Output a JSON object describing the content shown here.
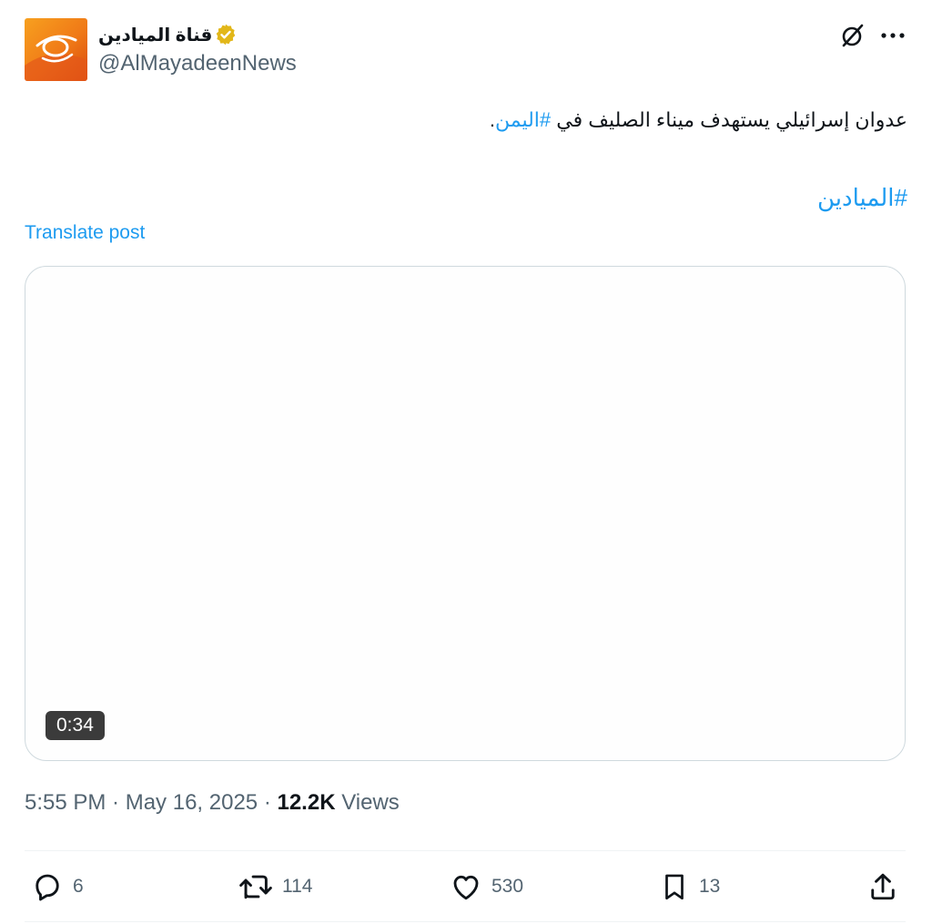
{
  "author": {
    "display_name": "قناة الميادين",
    "handle": "@AlMayadeenNews",
    "verified_icon": "verified-gold-badge-icon",
    "avatar_colors": {
      "orange": "#f07a17",
      "dark_orange": "#d9480b"
    }
  },
  "header_actions": {
    "grok_icon": "grok-icon",
    "more_icon": "more-horizontal-icon"
  },
  "post": {
    "line1_text": "عدوان إسرائيلي يستهدف ميناء الصليف في ",
    "line1_hashtag": "#اليمن",
    "line1_end": ".",
    "line2_hashtag": "#الميادين",
    "translate_label": "Translate post"
  },
  "media": {
    "duration": "0:34"
  },
  "meta": {
    "time": "5:55 PM",
    "separator": " · ",
    "date": "May 16, 2025",
    "separator2": " · ",
    "views_count": "12.2K",
    "views_label": " Views"
  },
  "actions": {
    "replies": "6",
    "retweets": "114",
    "likes": "530",
    "bookmarks": "13",
    "share_icon": "share-upload-icon"
  },
  "colors": {
    "accent": "#1d9bf0",
    "text": "#0f1419",
    "secondary": "#536471",
    "border": "#cfd9de"
  }
}
